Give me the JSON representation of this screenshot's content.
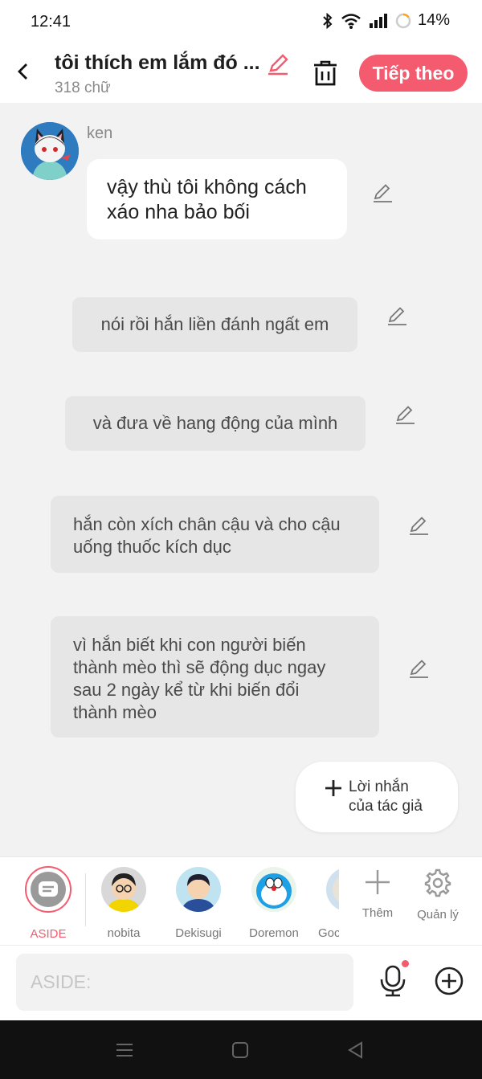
{
  "status": {
    "time": "12:41",
    "battery": "14%"
  },
  "header": {
    "title": "tôi thích em lắm đó ...",
    "word_count": "318 chữ",
    "next_label": "Tiếp theo"
  },
  "messages": {
    "ken": {
      "name": "ken",
      "text_line1": "vậy thù tôi không cách",
      "text_line2": "xáo nha bảo bối"
    },
    "m1": {
      "text": "nói rồi hắn liền đánh ngất em"
    },
    "m2": {
      "text": "và đưa về hang động của mình"
    },
    "m3": {
      "line1": "hắn còn xích chân cậu và cho cậu",
      "line2": "uống thuốc kích dục"
    },
    "m4": {
      "line1": "vì hắn biết khi con người biến",
      "line2": "thành mèo thì sẽ động dục ngay",
      "line3": "sau 2 ngày kể từ khi biến đổi",
      "line4": "thành mèo"
    }
  },
  "author_note": {
    "line1": "Lời nhắn",
    "line2": "của tác giả"
  },
  "characters": [
    {
      "label": "ASIDE"
    },
    {
      "label": "nobita"
    },
    {
      "label": "Dekisugi"
    },
    {
      "label": "Doremon"
    },
    {
      "label": "Goc"
    }
  ],
  "tools": {
    "add_label": "Thêm",
    "manage_label": "Quản lý"
  },
  "input": {
    "placeholder": "ASIDE:"
  },
  "colors": {
    "accent": "#f45b6e",
    "background": "#f2f2f2",
    "bubble_gray": "#e6e6e6"
  }
}
